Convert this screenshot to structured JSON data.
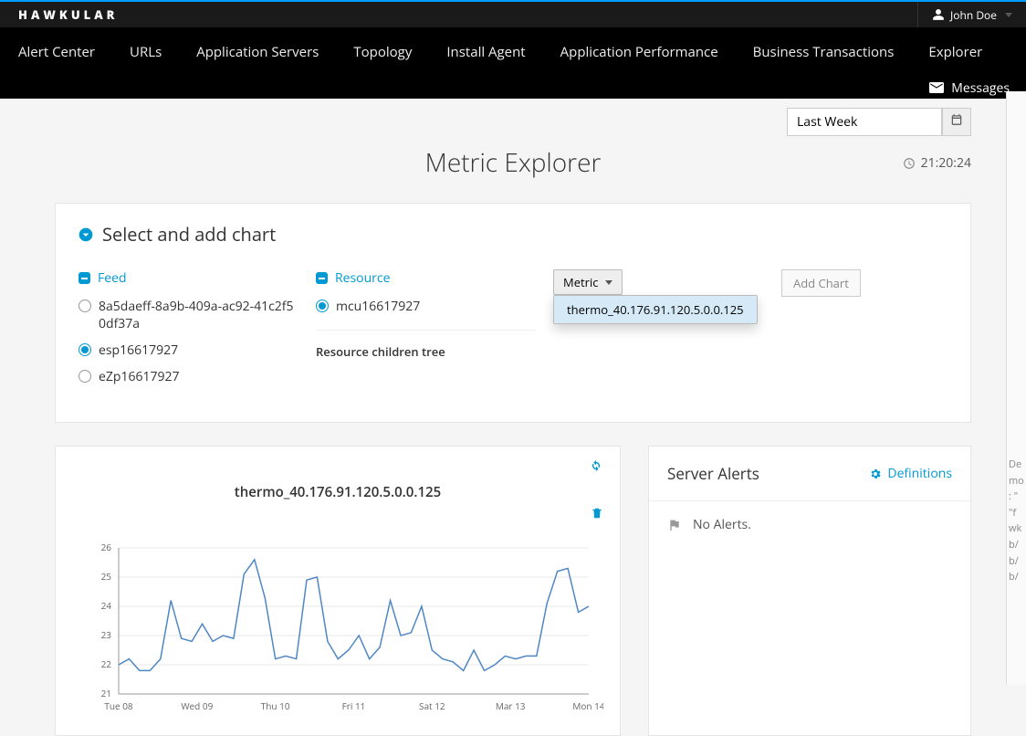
{
  "brand": "HAWKULAR",
  "user_name": "John Doe",
  "nav": [
    "Alert Center",
    "URLs",
    "Application Servers",
    "Topology",
    "Install Agent",
    "Application Performance",
    "Business Transactions",
    "Explorer"
  ],
  "messages_label": "Messages",
  "time_range": "Last Week",
  "page_title": "Metric Explorer",
  "clock": "21:20:24",
  "panel_title": "Select and add chart",
  "feed_label": "Feed",
  "resource_label": "Resource",
  "metric_label": "Metric",
  "add_chart_label": "Add Chart",
  "feeds": [
    {
      "id": "8a5daeff-8a9b-409a-ac92-41c2f50df37a",
      "selected": false
    },
    {
      "id": "esp16617927",
      "selected": true
    },
    {
      "id": "eZp16617927",
      "selected": false
    }
  ],
  "resources": [
    {
      "id": "mcu16617927",
      "selected": true
    }
  ],
  "resource_children_label": "Resource children tree",
  "metric_options": [
    "thermo_40.176.91.120.5.0.0.125"
  ],
  "chart_title": "thermo_40.176.91.120.5.0.0.125",
  "alerts_title": "Server Alerts",
  "definitions_label": "Definitions",
  "no_alerts_label": "No Alerts.",
  "sidecode_lines": [
    "De",
    "mo",
    ": \"",
    "\"f",
    "wk",
    "b/",
    "b/",
    "b/"
  ],
  "chart_data": {
    "type": "line",
    "title": "thermo_40.176.91.120.5.0.0.125",
    "xlabel": "",
    "ylabel": "",
    "ylim": [
      21,
      26
    ],
    "y_ticks": [
      21,
      22,
      23,
      24,
      25,
      26
    ],
    "x_categories": [
      "Tue 08",
      "Wed 09",
      "Thu 10",
      "Fri 11",
      "Sat 12",
      "Mar 13",
      "Mon 14"
    ],
    "series": [
      {
        "name": "thermo",
        "values": [
          22.0,
          22.2,
          21.8,
          21.8,
          22.2,
          24.2,
          22.9,
          22.8,
          23.4,
          22.8,
          23.0,
          22.9,
          25.1,
          25.6,
          24.3,
          22.2,
          22.3,
          22.2,
          24.9,
          25.0,
          22.8,
          22.2,
          22.5,
          23.0,
          22.2,
          22.6,
          24.2,
          23.0,
          23.1,
          24.0,
          22.5,
          22.2,
          22.1,
          21.8,
          22.5,
          21.8,
          22.0,
          22.3,
          22.2,
          22.3,
          22.3,
          24.1,
          25.2,
          25.3,
          23.8,
          24.0
        ]
      }
    ]
  }
}
